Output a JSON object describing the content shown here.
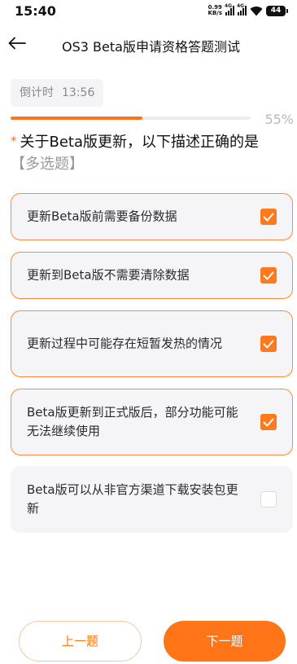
{
  "status_bar": {
    "time": "15:40",
    "net_speed_value": "0.99",
    "net_speed_unit": "KB/s",
    "signal_tag_1": "4G",
    "signal_tag_2": "4G",
    "battery_level": "44",
    "icons": [
      "signal-icon",
      "signal-icon",
      "wifi-icon",
      "battery-icon"
    ]
  },
  "header": {
    "back_icon": "arrow-left-icon",
    "title": "OS3 Beta版申请资格答题测试"
  },
  "countdown": {
    "label": "倒计时",
    "value": "13:56"
  },
  "progress": {
    "percent": 55,
    "percent_label": "55%"
  },
  "question": {
    "required_mark": "*",
    "text": "关于Beta版更新，以下描述正确的是",
    "type_label": "【多选题】"
  },
  "options": [
    {
      "text": "更新Beta版前需要备份数据",
      "checked": true
    },
    {
      "text": "更新到Beta版不需要清除数据",
      "checked": true
    },
    {
      "text": "更新过程中可能存在短暂发热的情况",
      "checked": true
    },
    {
      "text": "Beta版更新到正式版后，部分功能可能无法继续使用",
      "checked": true
    },
    {
      "text": "Beta版可以从非官方渠道下载安装包更新",
      "checked": false
    }
  ],
  "footer": {
    "prev_label": "上一题",
    "next_label": "下一题"
  },
  "colors": {
    "accent": "#ff7518",
    "selected_border": "#ff8a3a",
    "option_bg": "#f5f5f8"
  }
}
